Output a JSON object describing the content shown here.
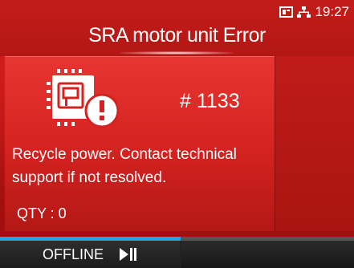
{
  "status_bar": {
    "time": "19:27",
    "icons": [
      "memory-card-icon",
      "network-icon"
    ]
  },
  "header": {
    "title": "SRA motor unit Error"
  },
  "error": {
    "code": "# 1133",
    "icon": "chip-warning-icon",
    "message": "Recycle power. Contact technical support if not resolved.",
    "qty": "QTY : 0"
  },
  "progress": {
    "value": 0.51
  },
  "footer": {
    "offline_label": "OFFLINE",
    "play_pause_icon": "play-pause-icon"
  },
  "colors": {
    "background_red": "#d11d1b",
    "progress_blue": "#1ea5e6",
    "footer_dark": "#222222"
  }
}
